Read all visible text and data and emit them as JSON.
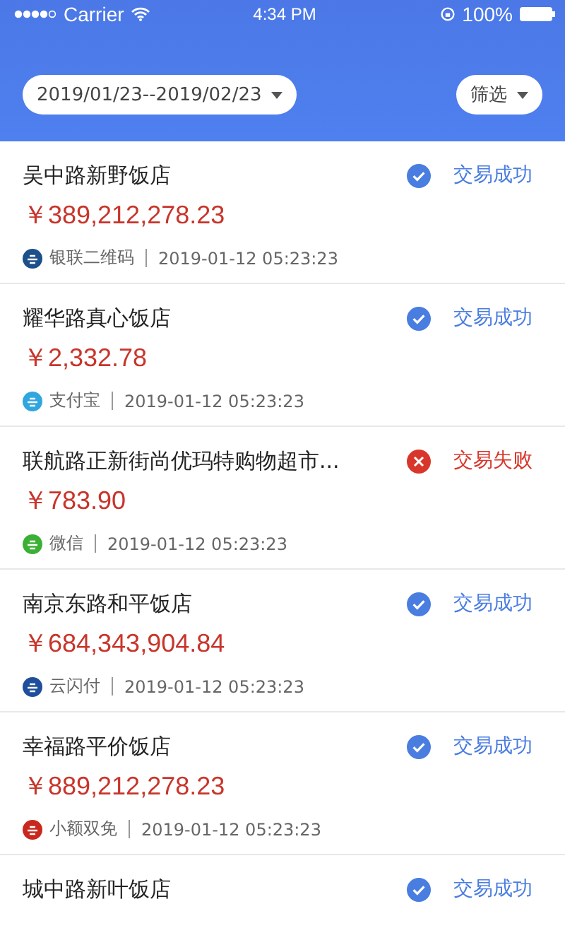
{
  "status_bar": {
    "carrier": "Carrier",
    "time": "4:34 PM",
    "battery": "100%"
  },
  "filters": {
    "date_range": "2019/01/23--2019/02/23",
    "filter": "筛选"
  },
  "transactions": [
    {
      "merchant": "吴中路新野饭店",
      "amount": "￥389,212,278.23",
      "payment": {
        "kind": "unionpay",
        "label": "银联二维码"
      },
      "time": "2019-01-12  05:23:23",
      "status": {
        "kind": "success",
        "label": "交易成功"
      }
    },
    {
      "merchant": "耀华路真心饭店",
      "amount": "￥2,332.78",
      "payment": {
        "kind": "alipay",
        "label": "支付宝"
      },
      "time": "2019-01-12  05:23:23",
      "status": {
        "kind": "success",
        "label": "交易成功"
      }
    },
    {
      "merchant": "联航路正新街尚优玛特购物超市...",
      "amount": "￥783.90",
      "payment": {
        "kind": "wechat",
        "label": "微信"
      },
      "time": "2019-01-12  05:23:23",
      "status": {
        "kind": "fail",
        "label": "交易失败"
      }
    },
    {
      "merchant": "南京东路和平饭店",
      "amount": "￥684,343,904.84",
      "payment": {
        "kind": "cloudpay",
        "label": "云闪付"
      },
      "time": "2019-01-12  05:23:23",
      "status": {
        "kind": "success",
        "label": "交易成功"
      }
    },
    {
      "merchant": "幸福路平价饭店",
      "amount": "￥889,212,278.23",
      "payment": {
        "kind": "free",
        "label": "小额双免"
      },
      "time": "2019-01-12  05:23:23",
      "status": {
        "kind": "success",
        "label": "交易成功"
      }
    },
    {
      "merchant": "城中路新叶饭店",
      "status": {
        "kind": "success",
        "label": "交易成功"
      }
    }
  ]
}
